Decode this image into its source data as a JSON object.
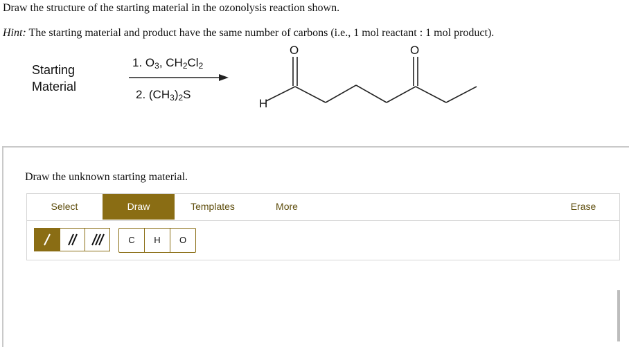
{
  "question": {
    "prompt": "Draw the structure of the starting material in the ozonolysis reaction shown.",
    "hint_label": "Hint:",
    "hint_text": " The starting material and product have the same number of carbons (i.e., 1 mol reactant : 1 mol product)."
  },
  "reaction": {
    "starting_label_line1": "Starting",
    "starting_label_line2": "Material",
    "reagent1_prefix": "1. O",
    "reagent1_sub1": "3",
    "reagent1_mid": ", CH",
    "reagent1_sub2": "2",
    "reagent1_mid2": "Cl",
    "reagent1_sub3": "2",
    "reagent2_prefix": "2. (CH",
    "reagent2_sub1": "3",
    "reagent2_mid": ")",
    "reagent2_sub2": "2",
    "reagent2_suffix": "S",
    "product_atoms": {
      "h": "H",
      "o1": "O",
      "o2": "O"
    }
  },
  "panel": {
    "prompt": "Draw the unknown starting material.",
    "tabs": [
      {
        "label": "Select",
        "active": false
      },
      {
        "label": "Draw",
        "active": true
      },
      {
        "label": "Templates",
        "active": false
      },
      {
        "label": "More",
        "active": false
      },
      {
        "label": "Erase",
        "active": false
      }
    ],
    "bonds": [
      "single-bond-icon",
      "double-bond-icon",
      "triple-bond-icon"
    ],
    "atoms": [
      "C",
      "H",
      "O"
    ]
  },
  "colors": {
    "accent": "#8a6d14",
    "accent_text": "#5e4d0c"
  }
}
